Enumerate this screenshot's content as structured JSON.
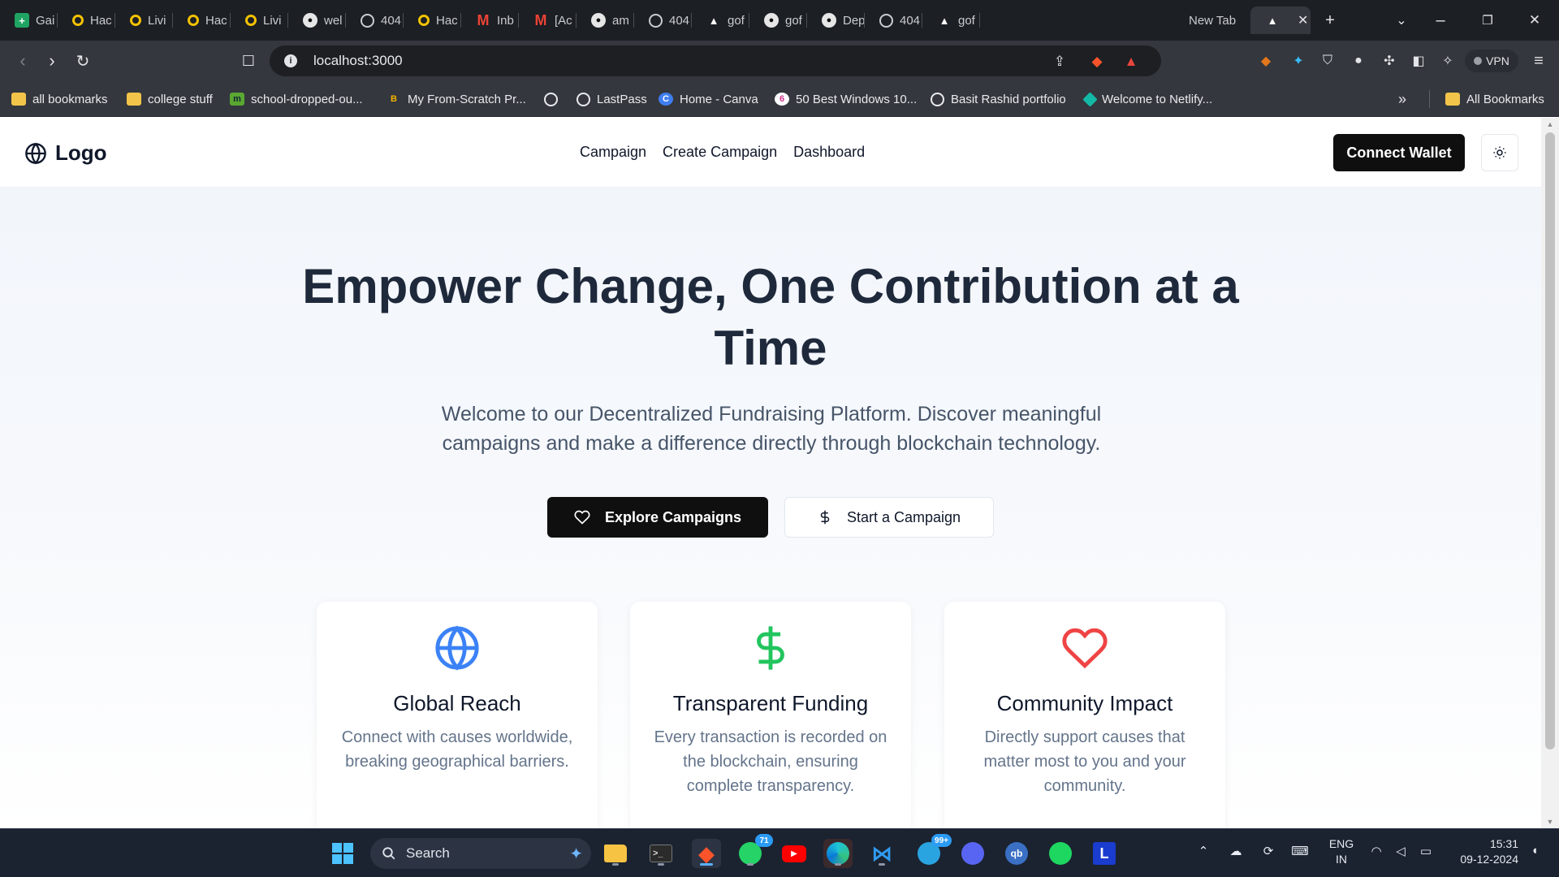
{
  "browser": {
    "tabs": [
      {
        "label": "Gai",
        "icon": "sheets-icon"
      },
      {
        "label": "Hac",
        "icon": "hack-icon"
      },
      {
        "label": "Livi",
        "icon": "hack-icon"
      },
      {
        "label": "Hac",
        "icon": "hack-icon"
      },
      {
        "label": "Livi",
        "icon": "hack-icon"
      },
      {
        "label": "wel",
        "icon": "github-icon"
      },
      {
        "label": "404",
        "icon": "globe-icon"
      },
      {
        "label": "Hac",
        "icon": "hack-icon"
      },
      {
        "label": "Inb",
        "icon": "gmail-icon"
      },
      {
        "label": "[Ac",
        "icon": "gmail-icon"
      },
      {
        "label": "am",
        "icon": "github-icon"
      },
      {
        "label": "404",
        "icon": "globe-icon"
      },
      {
        "label": "gof",
        "icon": "vercel-icon"
      },
      {
        "label": "gof",
        "icon": "github-icon"
      },
      {
        "label": "Dep",
        "icon": "github-icon"
      },
      {
        "label": "404",
        "icon": "globe-icon"
      },
      {
        "label": "gof",
        "icon": "vercel-icon"
      },
      {
        "label": "New Tab",
        "icon": ""
      }
    ],
    "url": "localhost:3000",
    "vpn_label": "VPN",
    "bookmarks": [
      {
        "label": "all bookmarks",
        "icon": "folder-icon"
      },
      {
        "label": "college stuff",
        "icon": "folder-icon"
      },
      {
        "label": "school-dropped-ou...",
        "icon": "site-icon"
      },
      {
        "label": "My From-Scratch Pr...",
        "icon": "blog-icon"
      },
      {
        "label": "",
        "icon": "globe-icon"
      },
      {
        "label": "LastPass",
        "icon": "globe-icon"
      },
      {
        "label": "Home - Canva",
        "icon": "canva-icon"
      },
      {
        "label": "50 Best Windows 10...",
        "icon": "site-icon"
      },
      {
        "label": "Basit Rashid portfolio",
        "icon": "globe-icon"
      },
      {
        "label": "Welcome to Netlify...",
        "icon": "netlify-icon"
      }
    ],
    "all_bookmarks_label": "All Bookmarks",
    "overflow_label": "»"
  },
  "site": {
    "logo_text": "Logo",
    "nav": [
      "Campaign",
      "Create Campaign",
      "Dashboard"
    ],
    "connect_wallet": "Connect Wallet",
    "hero": {
      "title": "Empower Change, One Contribution at a Time",
      "subtitle": "Welcome to our Decentralized Fundraising Platform. Discover meaningful campaigns and make a difference directly through blockchain technology.",
      "primary_cta": "Explore Campaigns",
      "secondary_cta": "Start a Campaign"
    },
    "features": [
      {
        "title": "Global Reach",
        "description": "Connect with causes worldwide, breaking geographical barriers.",
        "icon": "globe-icon",
        "color": "#3b82f6"
      },
      {
        "title": "Transparent Funding",
        "description": "Every transaction is recorded on the blockchain, ensuring complete transparency.",
        "icon": "dollar-icon",
        "color": "#22c55e"
      },
      {
        "title": "Community Impact",
        "description": "Directly support causes that matter most to you and your community.",
        "icon": "heart-icon",
        "color": "#ef4444"
      }
    ]
  },
  "taskbar": {
    "search_label": "Search",
    "whatsapp_badge": "71",
    "telegram_badge": "99+",
    "lang_line1": "ENG",
    "lang_line2": "IN",
    "time": "15:31",
    "date": "09-12-2024",
    "apps": [
      "start",
      "search",
      "file-explorer",
      "terminal",
      "brave",
      "whatsapp",
      "youtube",
      "edge",
      "vscode",
      "telegram",
      "discord",
      "qbittorrent",
      "spotify",
      "l-app"
    ]
  }
}
